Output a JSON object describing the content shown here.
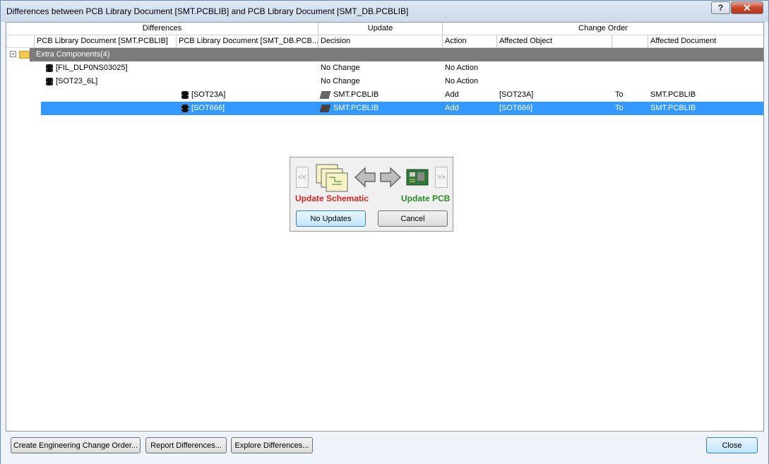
{
  "window": {
    "title": "Differences between PCB Library Document [SMT.PCBLIB] and PCB Library Document [SMT_DB.PCBLIB]",
    "help_label": "?",
    "close_glyph": "✕"
  },
  "table": {
    "group_headers": {
      "differences": "Differences",
      "update": "Update",
      "change_order": "Change Order"
    },
    "columns": {
      "doc1": "PCB Library Document [SMT.PCBLIB]",
      "doc2": "PCB Library Document [SMT_DB.PCB...",
      "decision": "Decision",
      "action": "Action",
      "affected_object": "Affected Object",
      "affected_document": "Affected Document"
    },
    "group": {
      "label": "Extra Components(4)",
      "expander": "−"
    },
    "rows": [
      {
        "doc1": "[FIL_DLP0NS03025]",
        "doc2": "",
        "decision": "No Change",
        "action": "No Action",
        "object": "",
        "to": "",
        "document": ""
      },
      {
        "doc1": "[SOT23_6L]",
        "doc2": "",
        "decision": "No Change",
        "action": "No Action",
        "object": "",
        "to": "",
        "document": ""
      },
      {
        "doc1": "",
        "doc2": "[SOT23A]",
        "decision": "SMT.PCBLIB",
        "action": "Add",
        "object": "[SOT23A]",
        "to": "To",
        "document": "SMT.PCBLIB"
      },
      {
        "doc1": "",
        "doc2": "[SOT666]",
        "decision": "SMT.PCBLIB",
        "action": "Add",
        "object": "[SOT666]",
        "to": "To",
        "document": "SMT.PCBLIB"
      }
    ]
  },
  "popup": {
    "prev_label": "<<",
    "next_label": ">>",
    "update_schematic": "Update Schematic",
    "update_pcb": "Update PCB",
    "no_updates": "No Updates",
    "cancel": "Cancel"
  },
  "footer": {
    "create_eco": "Create Engineering Change Order...",
    "report": "Report Differences...",
    "explore": "Explore Differences...",
    "close": "Close"
  },
  "colors": {
    "selection": "#3399ff",
    "group_row": "#7b7b7b",
    "update_schematic": "#dd2222",
    "update_pcb": "#2a8c2a"
  }
}
